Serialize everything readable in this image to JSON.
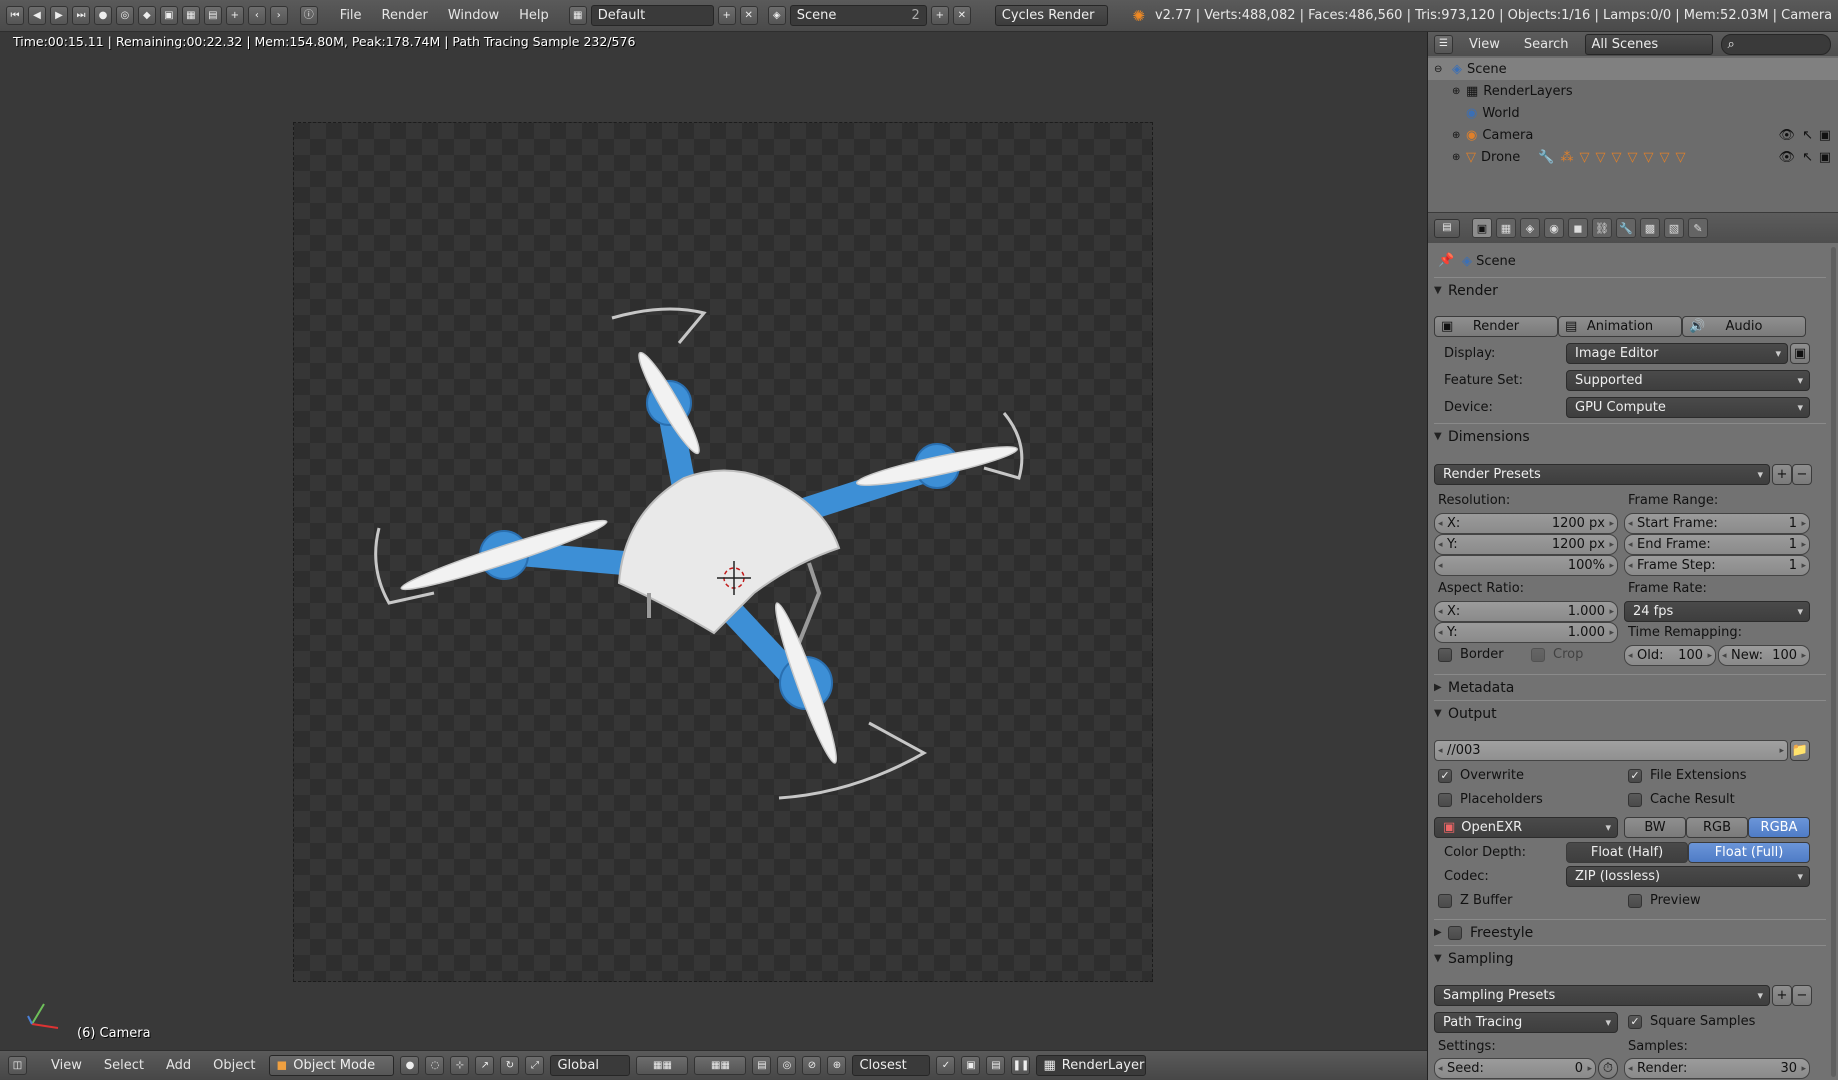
{
  "topbar": {
    "menus": [
      "File",
      "Render",
      "Window",
      "Help"
    ],
    "layout": "Default",
    "scene": "Scene",
    "scene_users": "2",
    "engine": "Cycles Render",
    "info": "v2.77 | Verts:488,082 | Faces:486,560 | Tris:973,120 | Objects:1/16 | Lamps:0/0 | Mem:52.03M | Camera"
  },
  "viewport": {
    "status": "Time:00:15.11 | Remaining:00:22.32 | Mem:154.80M, Peak:178.74M | Path Tracing Sample 232/576",
    "camera_label": "(6) Camera"
  },
  "bottombar": {
    "menus": [
      "View",
      "Select",
      "Add",
      "Object"
    ],
    "mode": "Object Mode",
    "orientation": "Global",
    "snap": "Closest",
    "render_layer": "RenderLayer"
  },
  "outliner": {
    "menus": [
      "View",
      "Search"
    ],
    "filter": "All Scenes",
    "rows": [
      {
        "label": "Scene"
      },
      {
        "label": "RenderLayers"
      },
      {
        "label": "World"
      },
      {
        "label": "Camera"
      },
      {
        "label": "Drone"
      }
    ]
  },
  "props": {
    "context": "Scene",
    "render": {
      "title": "Render",
      "buttons": [
        "Render",
        "Animation",
        "Audio"
      ],
      "display_label": "Display:",
      "display": "Image Editor",
      "feature_label": "Feature Set:",
      "feature": "Supported",
      "device_label": "Device:",
      "device": "GPU Compute"
    },
    "dimensions": {
      "title": "Dimensions",
      "presets": "Render Presets",
      "resolution_label": "Resolution:",
      "res_x_label": "X:",
      "res_x": "1200 px",
      "res_y_label": "Y:",
      "res_y": "1200 px",
      "res_pct": "100%",
      "frame_range_label": "Frame Range:",
      "start_label": "Start Frame:",
      "start": "1",
      "end_label": "End Frame:",
      "end": "1",
      "step_label": "Frame Step:",
      "step": "1",
      "aspect_label": "Aspect Ratio:",
      "asp_x_label": "X:",
      "asp_x": "1.000",
      "asp_y_label": "Y:",
      "asp_y": "1.000",
      "frame_rate_label": "Frame Rate:",
      "frame_rate": "24 fps",
      "remap_label": "Time Remapping:",
      "old_label": "Old:",
      "old": "100",
      "new_label": "New:",
      "new": "100",
      "border": "Border",
      "crop": "Crop"
    },
    "metadata": {
      "title": "Metadata"
    },
    "output": {
      "title": "Output",
      "path": "//003",
      "overwrite": "Overwrite",
      "file_ext": "File Extensions",
      "placeholders": "Placeholders",
      "cache": "Cache Result",
      "format": "OpenEXR",
      "bw": "BW",
      "rgb": "RGB",
      "rgba": "RGBA",
      "depth_label": "Color Depth:",
      "half": "Float (Half)",
      "full": "Float (Full)",
      "codec_label": "Codec:",
      "codec": "ZIP (lossless)",
      "zbuffer": "Z Buffer",
      "preview": "Preview"
    },
    "freestyle": {
      "title": "Freestyle"
    },
    "sampling": {
      "title": "Sampling",
      "presets": "Sampling Presets",
      "integrator": "Path Tracing",
      "square": "Square Samples",
      "settings_label": "Settings:",
      "samples_label": "Samples:",
      "seed_label": "Seed:",
      "seed": "0",
      "render_label": "Render:",
      "render_samples": "30"
    }
  }
}
